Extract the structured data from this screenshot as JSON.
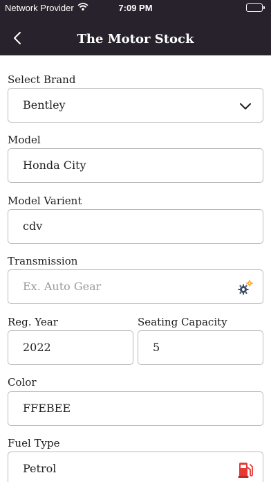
{
  "status": {
    "carrier": "Network Provider",
    "time": "7:09 PM"
  },
  "header": {
    "title": "The Motor Stock"
  },
  "form": {
    "brand": {
      "label": "Select Brand",
      "value": "Bentley",
      "icon": "chevron-down-icon"
    },
    "model": {
      "label": "Model",
      "value": "Honda City"
    },
    "variant": {
      "label": "Model Varient",
      "value": "cdv"
    },
    "transmission": {
      "label": "Transmission",
      "placeholder": "Ex. Auto Gear",
      "icon": "gears-icon"
    },
    "reg_year": {
      "label": "Reg. Year",
      "value": "2022"
    },
    "seating": {
      "label": "Seating Capacity",
      "value": "5"
    },
    "color": {
      "label": "Color",
      "value": "FFEBEE"
    },
    "fuel": {
      "label": "Fuel Type",
      "value": "Petrol",
      "icon": "fuel-pump-icon"
    }
  },
  "colors": {
    "header_bg": "#27222b",
    "border": "#b9b9b9",
    "fuel_icon": "#e53935",
    "gear_icon_dark": "#3b4a66",
    "gear_icon_accent": "#f5a623"
  }
}
